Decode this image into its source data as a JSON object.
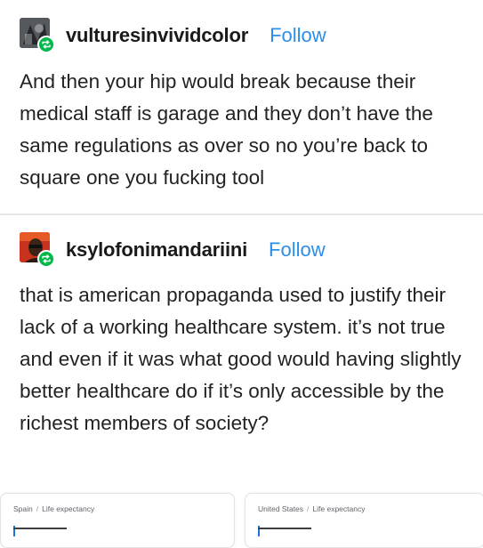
{
  "posts": [
    {
      "username": "vulturesinvividcolor",
      "follow_label": "Follow",
      "avatar_icon": "user-avatar",
      "badge_icon": "reblog-icon",
      "badge_color": "#00b84a",
      "body": "And then your hip would break because their medical staff is garage and they don’t have the same regulations as over so no you’re back to square one you fucking tool"
    },
    {
      "username": "ksylofonimandariini",
      "follow_label": "Follow",
      "avatar_icon": "user-avatar",
      "badge_icon": "reblog-icon",
      "badge_color": "#00b84a",
      "body": "that is american propaganda used to justify their lack of a working healthcare system. it’s not true and even if it was what good would having slightly better healthcare do if it’s only accessible by the richest members of society?"
    }
  ],
  "cards": [
    {
      "country": "Spain",
      "topic": "Life expectancy"
    },
    {
      "country": "United States",
      "topic": "Life expectancy"
    }
  ],
  "colors": {
    "link": "#2b8ee8",
    "text": "#222222",
    "divider": "#e6e6e6"
  }
}
